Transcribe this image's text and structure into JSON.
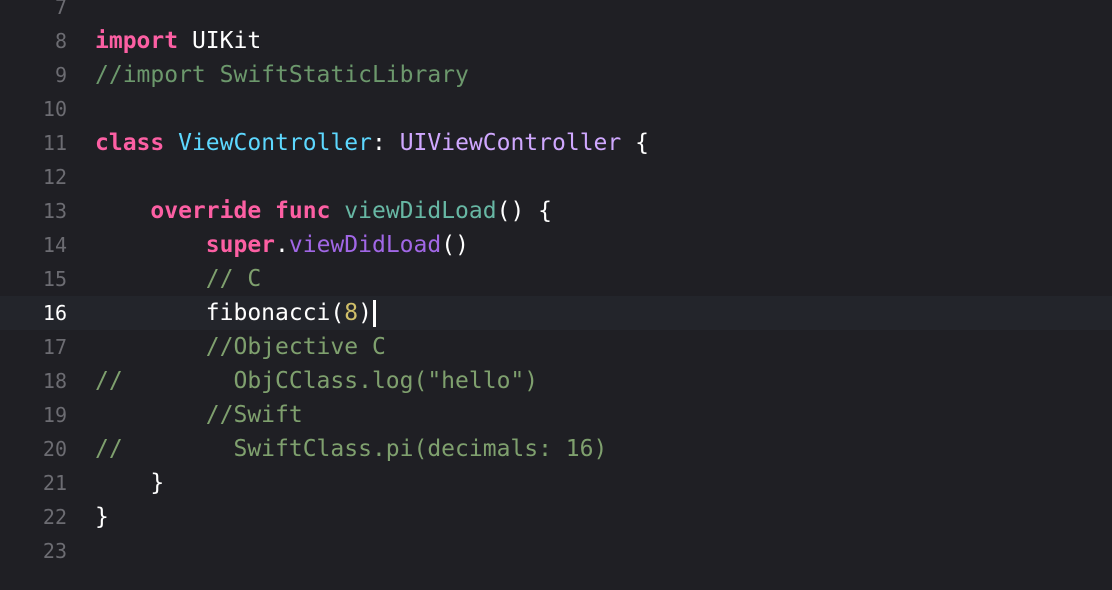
{
  "editor": {
    "current_line": "16",
    "lines": [
      {
        "num": "7",
        "tokens": []
      },
      {
        "num": "8",
        "tokens": [
          {
            "c": "kw",
            "t": "import"
          },
          {
            "c": "pl",
            "t": " UIKit"
          }
        ]
      },
      {
        "num": "9",
        "tokens": [
          {
            "c": "cm",
            "t": "//import SwiftStaticLibrary"
          }
        ]
      },
      {
        "num": "10",
        "tokens": []
      },
      {
        "num": "11",
        "tokens": [
          {
            "c": "kw",
            "t": "class"
          },
          {
            "c": "pl",
            "t": " "
          },
          {
            "c": "decl",
            "t": "ViewController"
          },
          {
            "c": "pl",
            "t": ": "
          },
          {
            "c": "type",
            "t": "UIViewController"
          },
          {
            "c": "pl",
            "t": " {"
          }
        ]
      },
      {
        "num": "12",
        "tokens": []
      },
      {
        "num": "13",
        "tokens": [
          {
            "c": "pl",
            "t": "    "
          },
          {
            "c": "kw",
            "t": "override"
          },
          {
            "c": "pl",
            "t": " "
          },
          {
            "c": "kw",
            "t": "func"
          },
          {
            "c": "pl",
            "t": " "
          },
          {
            "c": "fn",
            "t": "viewDidLoad"
          },
          {
            "c": "pl",
            "t": "() {"
          }
        ]
      },
      {
        "num": "14",
        "tokens": [
          {
            "c": "pl",
            "t": "        "
          },
          {
            "c": "kw",
            "t": "super"
          },
          {
            "c": "pl",
            "t": "."
          },
          {
            "c": "call",
            "t": "viewDidLoad"
          },
          {
            "c": "pl",
            "t": "()"
          }
        ]
      },
      {
        "num": "15",
        "tokens": [
          {
            "c": "pl",
            "t": "        "
          },
          {
            "c": "cm2",
            "t": "// C"
          }
        ]
      },
      {
        "num": "16",
        "tokens": [
          {
            "c": "pl",
            "t": "        fibonacci("
          },
          {
            "c": "num",
            "t": "8"
          },
          {
            "c": "pl",
            "t": ")"
          }
        ],
        "cursor": true
      },
      {
        "num": "17",
        "tokens": [
          {
            "c": "pl",
            "t": "        "
          },
          {
            "c": "cm2",
            "t": "//Objective C"
          }
        ]
      },
      {
        "num": "18",
        "tokens": [
          {
            "c": "cm2",
            "t": "//        ObjCClass.log(\"hello\")"
          }
        ]
      },
      {
        "num": "19",
        "tokens": [
          {
            "c": "pl",
            "t": "        "
          },
          {
            "c": "cm2",
            "t": "//Swift"
          }
        ]
      },
      {
        "num": "20",
        "tokens": [
          {
            "c": "cm2",
            "t": "//        SwiftClass.pi(decimals: 16)"
          }
        ]
      },
      {
        "num": "21",
        "tokens": [
          {
            "c": "pl",
            "t": "    }"
          }
        ]
      },
      {
        "num": "22",
        "tokens": [
          {
            "c": "pl",
            "t": "}"
          }
        ]
      },
      {
        "num": "23",
        "tokens": []
      }
    ]
  },
  "colors": {
    "background": "#1f1f24",
    "current_line_background": "#23252b",
    "keyword": "#fc5fa3",
    "comment": "#6c986c",
    "declaration": "#5dd8ff",
    "type": "#d0a8ff",
    "function": "#67b7a4",
    "method_call": "#a167e6",
    "number": "#d0bf69",
    "plain": "#ffffff",
    "line_number": "#6c6c72",
    "change_marker": "#3a6fd6"
  }
}
